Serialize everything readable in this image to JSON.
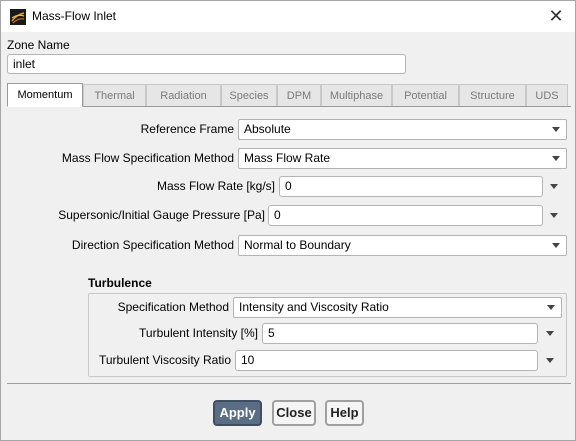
{
  "window": {
    "title": "Mass-Flow Inlet",
    "close_glyph": "✕",
    "icon": "fluent-logo-icon"
  },
  "zone": {
    "label": "Zone Name",
    "value": "inlet"
  },
  "tabs": [
    {
      "label": "Momentum",
      "active": true
    },
    {
      "label": "Thermal",
      "active": false
    },
    {
      "label": "Radiation",
      "active": false
    },
    {
      "label": "Species",
      "active": false
    },
    {
      "label": "DPM",
      "active": false
    },
    {
      "label": "Multiphase",
      "active": false
    },
    {
      "label": "Potential",
      "active": false
    },
    {
      "label": "Structure",
      "active": false
    },
    {
      "label": "UDS",
      "active": false
    }
  ],
  "momentum": {
    "reference_frame": {
      "label": "Reference Frame",
      "value": "Absolute"
    },
    "mass_flow_spec": {
      "label": "Mass Flow Specification Method",
      "value": "Mass Flow Rate"
    },
    "mass_flow_rate": {
      "label": "Mass Flow Rate [kg/s]",
      "value": "0"
    },
    "gauge_pressure": {
      "label": "Supersonic/Initial Gauge Pressure [Pa]",
      "value": "0"
    },
    "direction_spec": {
      "label": "Direction Specification Method",
      "value": "Normal to Boundary"
    }
  },
  "turbulence": {
    "title": "Turbulence",
    "spec_method": {
      "label": "Specification Method",
      "value": "Intensity and Viscosity Ratio"
    },
    "intensity": {
      "label": "Turbulent Intensity [%]",
      "value": "5"
    },
    "viscosity_ratio": {
      "label": "Turbulent Viscosity Ratio",
      "value": "10"
    }
  },
  "buttons": {
    "apply": "Apply",
    "close": "Close",
    "help": "Help"
  }
}
